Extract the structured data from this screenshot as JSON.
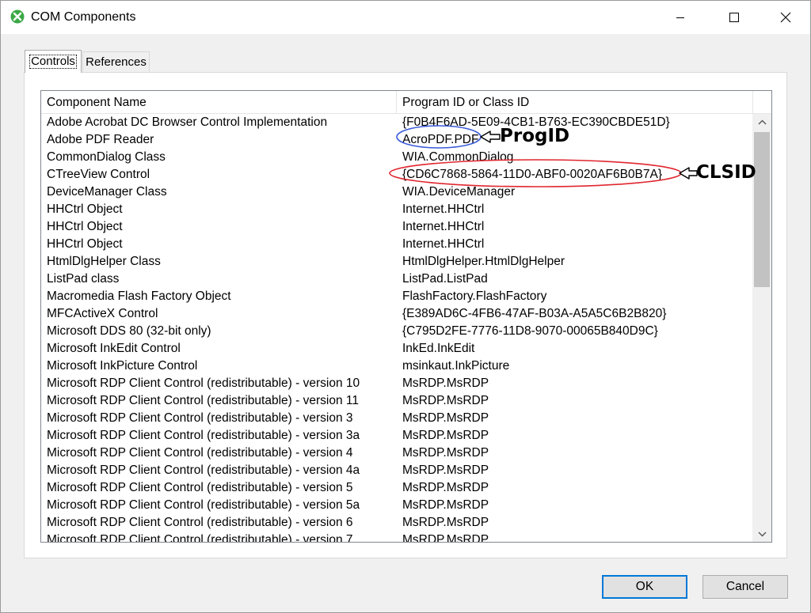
{
  "window": {
    "title": "COM Components",
    "icon": "green-circle-x-icon",
    "controls": [
      "minimize-icon",
      "maximize-icon",
      "close-icon"
    ]
  },
  "tabs": [
    {
      "label": "Controls",
      "selected": true
    },
    {
      "label": "References",
      "selected": false
    }
  ],
  "list": {
    "columns": [
      "Component Name",
      "Program ID or Class ID"
    ],
    "rows": [
      {
        "name": "Adobe Acrobat DC Browser Control Implementation",
        "id": "{F0B4F6AD-5E09-4CB1-B763-EC390CBDE51D}"
      },
      {
        "name": "Adobe PDF Reader",
        "id": "AcroPDF.PDF"
      },
      {
        "name": "CommonDialog Class",
        "id": "WIA.CommonDialog"
      },
      {
        "name": "CTreeView Control",
        "id": "{CD6C7868-5864-11D0-ABF0-0020AF6B0B7A}"
      },
      {
        "name": "DeviceManager Class",
        "id": "WIA.DeviceManager"
      },
      {
        "name": "HHCtrl Object",
        "id": "Internet.HHCtrl"
      },
      {
        "name": "HHCtrl Object",
        "id": "Internet.HHCtrl"
      },
      {
        "name": "HHCtrl Object",
        "id": "Internet.HHCtrl"
      },
      {
        "name": "HtmlDlgHelper Class",
        "id": "HtmlDlgHelper.HtmlDlgHelper"
      },
      {
        "name": "ListPad class",
        "id": "ListPad.ListPad"
      },
      {
        "name": "Macromedia Flash Factory Object",
        "id": "FlashFactory.FlashFactory"
      },
      {
        "name": "MFCActiveX Control",
        "id": "{E389AD6C-4FB6-47AF-B03A-A5A5C6B2B820}"
      },
      {
        "name": "Microsoft DDS 80 (32-bit only)",
        "id": "{C795D2FE-7776-11D8-9070-00065B840D9C}"
      },
      {
        "name": "Microsoft InkEdit Control",
        "id": "InkEd.InkEdit"
      },
      {
        "name": "Microsoft InkPicture Control",
        "id": "msinkaut.InkPicture"
      },
      {
        "name": "Microsoft RDP Client Control (redistributable) - version 10",
        "id": "MsRDP.MsRDP"
      },
      {
        "name": "Microsoft RDP Client Control (redistributable) - version 11",
        "id": "MsRDP.MsRDP"
      },
      {
        "name": "Microsoft RDP Client Control (redistributable) - version 3",
        "id": "MsRDP.MsRDP"
      },
      {
        "name": "Microsoft RDP Client Control (redistributable) - version 3a",
        "id": "MsRDP.MsRDP"
      },
      {
        "name": "Microsoft RDP Client Control (redistributable) - version 4",
        "id": "MsRDP.MsRDP"
      },
      {
        "name": "Microsoft RDP Client Control (redistributable) - version 4a",
        "id": "MsRDP.MsRDP"
      },
      {
        "name": "Microsoft RDP Client Control (redistributable) - version 5",
        "id": "MsRDP.MsRDP"
      },
      {
        "name": "Microsoft RDP Client Control (redistributable) - version 5a",
        "id": "MsRDP.MsRDP"
      },
      {
        "name": "Microsoft RDP Client Control (redistributable) - version 6",
        "id": "MsRDP.MsRDP"
      },
      {
        "name": "Microsoft RDP Client Control (redistributable) - version 7",
        "id": "MsRDP.MsRDP"
      }
    ]
  },
  "annotations": {
    "progid_label": "ProgID",
    "clsid_label": "CLSID",
    "progid_color": "#3a5bd9",
    "clsid_color": "#e0262e"
  },
  "buttons": {
    "ok": "OK",
    "cancel": "Cancel"
  }
}
